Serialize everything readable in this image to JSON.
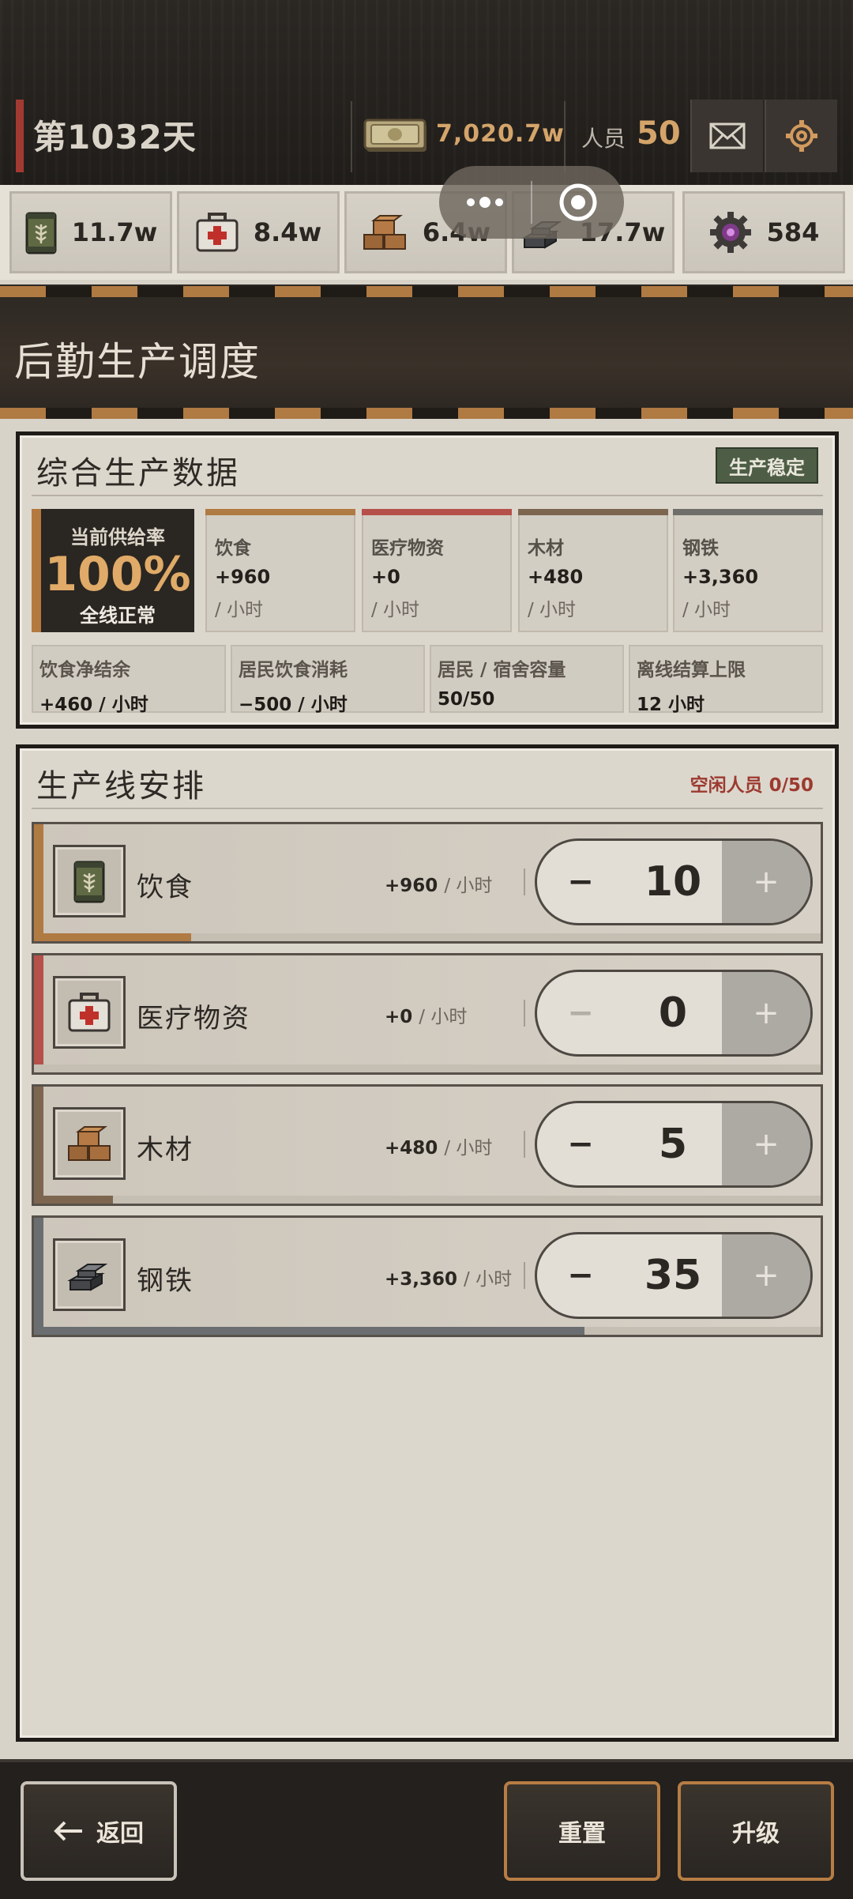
{
  "header": {
    "day_label": "第1032天",
    "money": "7,020.7w",
    "people_label": "人员",
    "people_count": "50"
  },
  "resources": [
    {
      "icon": "food-can-icon",
      "value": "11.7w"
    },
    {
      "icon": "medkit-icon",
      "value": "8.4w"
    },
    {
      "icon": "wood-icon",
      "value": "6.4w"
    },
    {
      "icon": "steel-icon",
      "value": "17.7w"
    },
    {
      "icon": "gear-core-icon",
      "value": "584"
    }
  ],
  "banner": {
    "title": "后勤生产调度"
  },
  "overview": {
    "title": "综合生产数据",
    "badge": "生产稳定",
    "supply_label": "当前供给率",
    "supply_value": "100%",
    "supply_status": "全线正常",
    "stats": [
      {
        "name": "饮食",
        "value": "+960",
        "unit": "/ 小时",
        "color": "#b07a43"
      },
      {
        "name": "医疗物资",
        "value": "+0",
        "unit": "/ 小时",
        "color": "#b5504a"
      },
      {
        "name": "木材",
        "value": "+480",
        "unit": "/ 小时",
        "color": "#7d6650"
      },
      {
        "name": "钢铁",
        "value": "+3,360",
        "unit": "/ 小时",
        "color": "#6f6e6a"
      }
    ],
    "summary": [
      {
        "key": "饮食净结余",
        "value_num": "+460 / ",
        "value_unit": "小时"
      },
      {
        "key": "居民饮食消耗",
        "value_num": "−500 / ",
        "value_unit": "小时"
      },
      {
        "key": "居民 / 宿舍容量",
        "value_num": "50/50",
        "value_unit": ""
      },
      {
        "key": "离线结算上限",
        "value_num": "12 ",
        "value_unit": "小时"
      }
    ]
  },
  "production": {
    "title": "生产线安排",
    "idle": "空闲人员 0/50",
    "lines": [
      {
        "name": "饮食",
        "rate": "+960",
        "unit": "/ 小时",
        "count": "10",
        "minus": "−",
        "plus": "+",
        "color": "#b07a43",
        "fill_fraction": 0.2
      },
      {
        "name": "医疗物资",
        "rate": "+0",
        "unit": "/ 小时",
        "count": "0",
        "minus": "−",
        "plus": "+",
        "color": "#b5504a",
        "fill_fraction": 0
      },
      {
        "name": "木材",
        "rate": "+480",
        "unit": "/ 小时",
        "count": "5",
        "minus": "−",
        "plus": "+",
        "color": "#7d6650",
        "fill_fraction": 0.1
      },
      {
        "name": "钢铁",
        "rate": "+3,360",
        "unit": "/ 小时",
        "count": "35",
        "minus": "−",
        "plus": "+",
        "color": "#6b6e70",
        "fill_fraction": 0.7
      }
    ]
  },
  "footer": {
    "back": "返回",
    "reset": "重置",
    "upgrade": "升级"
  }
}
